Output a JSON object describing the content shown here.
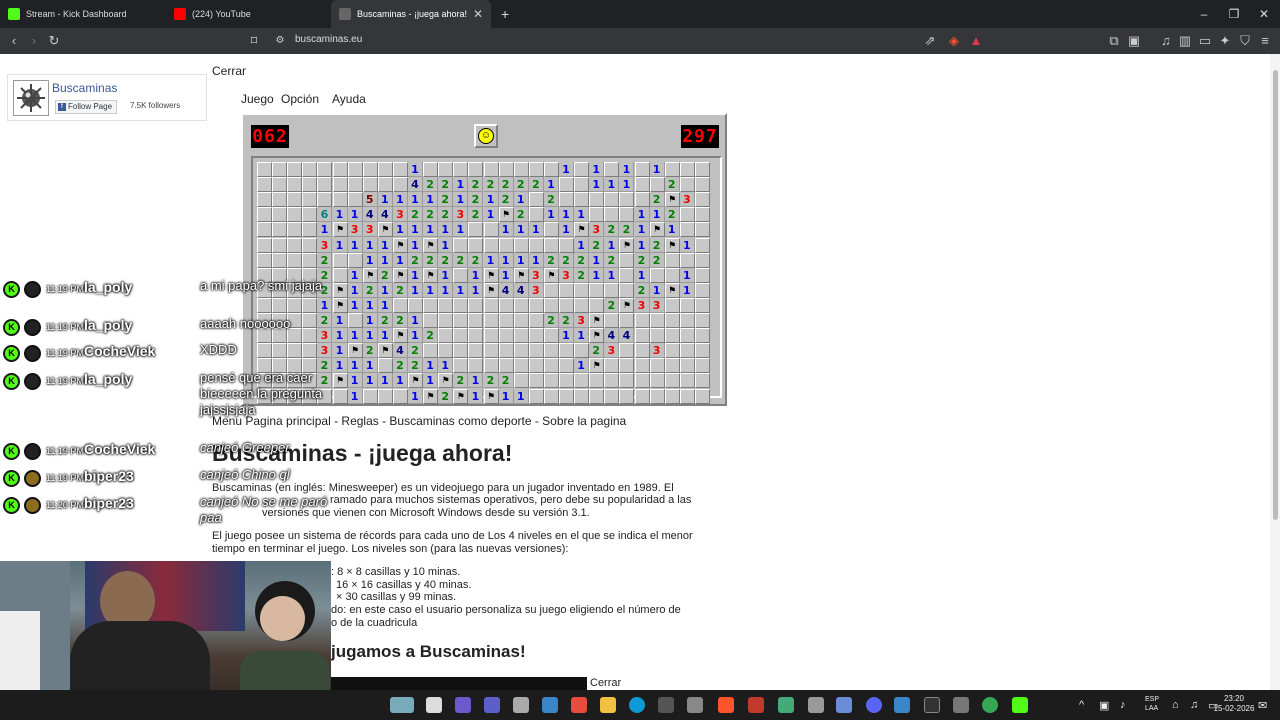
{
  "tabs": [
    {
      "title": "Stream - Kick Dashboard",
      "color": "#53fc18"
    },
    {
      "title": "(224) YouTube",
      "color": "#ff0000"
    },
    {
      "title": "Buscaminas - ¡juega ahora!",
      "color": "#666666",
      "active": true
    }
  ],
  "url": "buscaminas.eu",
  "fb": {
    "name": "Buscaminas",
    "follow": "Follow Page",
    "followers": "7.5K followers"
  },
  "cerrar": "Cerrar",
  "menu": [
    "Juego",
    "Opción",
    "Ayuda"
  ],
  "mine_counter": "062",
  "timer": "297",
  "smiley": "☺",
  "nav_links": "Menu  Pagina principal - Reglas - Buscaminas como deporte - Sobre la pagina",
  "heading": "Buscaminas - ¡juega ahora!",
  "p1": "Buscaminas (en inglés: Minesweeper) es un videojuego para un jugador inventado en 1989. El",
  "p1_italic": "Minesweeper",
  "p2": "ramado para muchos sistemas operativos, pero debe su popularidad a las",
  "p3": "versiones que vienen con Microsoft Windows desde su versión 3.1.",
  "p4": "El juego posee un sistema de récords para cada uno de Los 4 niveles en el que se indica el menor",
  "p5": "tiempo en terminar el juego. Los niveles son (para las nuevas versiones):",
  "l1": ": 8 × 8 casillas y 10 minas.",
  "l2": "16 × 16 casillas y 40 minas.",
  "l3": "× 30 casillas y 99 minas.",
  "l4": "do: en este caso el usuario personaliza su juego eligiendo el número de",
  "l5": "o de la cuadricula",
  "heading2": "jugamos a Buscaminas!",
  "cerrar2": "Cerrar",
  "chat": [
    {
      "time": "11:19 PM",
      "user": "la_poly",
      "msg": "a mi papa? smi jajaja"
    },
    {
      "time": "11:19 PM",
      "user": "la_poly",
      "msg": "aaaah noooooo"
    },
    {
      "time": "11:19 PM",
      "user": "CocheViek",
      "msg": "XDDD"
    },
    {
      "time": "11:19 PM",
      "user": "la_poly",
      "msg": "pensé que era caer bieeeeen la pregunta jajssjsjaja"
    },
    {
      "time": "11:19 PM",
      "user": "CocheViek",
      "msg": "canjeó Greeper"
    },
    {
      "time": "11:19 PM",
      "user": "biper23",
      "msg": "canjeó Chino ql"
    },
    {
      "time": "11:20 PM",
      "user": "biper23",
      "msg": "canjeó No se me paró paa"
    }
  ],
  "tray": {
    "lang": "ESP",
    "lang2": "LAA",
    "time": "23:20",
    "date": "15-02-2026"
  },
  "minefield": [
    "..........1.........1.1.1.1.........",
    "..........4221222221..111..2........",
    ".......51111212121.2......2F3.......",
    "....611443222321F2.111...112........",
    "....1F33F11111..111.1F3221F1........",
    "....31111F1F1........121F12F1.......",
    "....2..11122222111122212.22.........",
    "....2.1F2F1F1.1F1F3F3211.1..1.......",
    "....2F121211111F443......21F1.......",
    "....1F111..............2F33.........",
    "....21.1221........223F.............",
    "....31111F12........11F44...........",
    "....31F2F42...........23..3.........",
    "....2111.2211........1F.............",
    "....2F1111F1F2122...................",
    "......1...1F2F1F11..................."
  ]
}
